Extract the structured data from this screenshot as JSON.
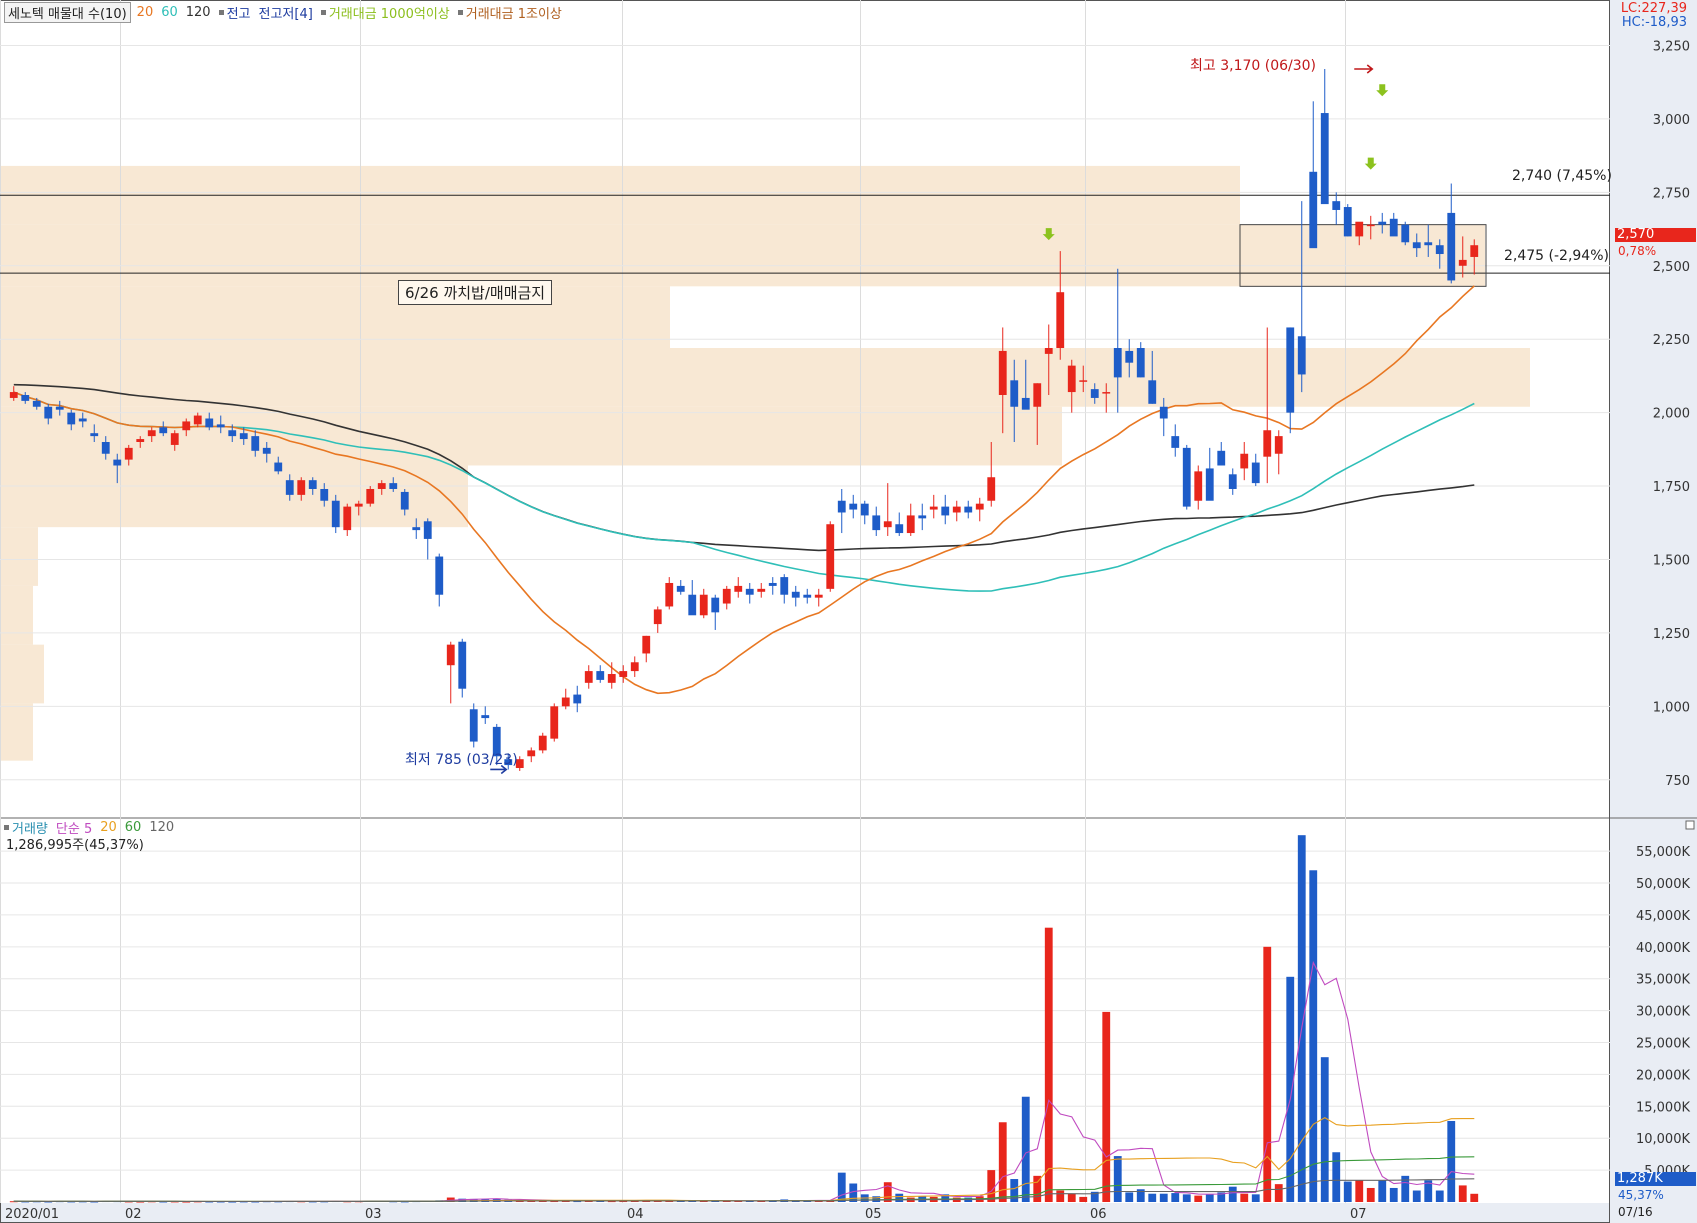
{
  "legend_top": {
    "title_box": "세노텍 매물대 수(10)",
    "ma20": "20",
    "ma60": "60",
    "ma120": "120",
    "item_high_low": "전고",
    "item_high_low2": "전고저[4]",
    "item_value1": "거래대금 1000억이상",
    "item_value2": "거래대금 1조이상"
  },
  "legend_volume": {
    "title": "거래량",
    "simple": "단순 5",
    "ma20": "20",
    "ma60": "60",
    "ma120": "120",
    "current": "1,286,995주(45,37%)"
  },
  "corner": {
    "lc": "LC:227,39",
    "hc": "HC:-18,93"
  },
  "annotations": {
    "high_label": "최고 3,170 (06/30)",
    "low_label": "최저 785 (03/23)",
    "note_box": "6/26 까치밥/매매금지",
    "line_upper": "2,740 (7,45%)",
    "line_lower": "2,475 (-2,94%)",
    "price_tag": "2,570",
    "price_pct": "0,78%",
    "vol_tag": "1,287K",
    "vol_pct": "45,37%",
    "date_end": "07/16"
  },
  "colors": {
    "up": "#e8261c",
    "down": "#1e5cc8",
    "ma5": "#e87722",
    "ma20": "#2fbfb8",
    "ma120": "#333333",
    "zone": "#f7e4cc",
    "vol_ma5": "#c04bc0",
    "vol_ma20": "#e8a020",
    "vol_ma60": "#3a9a3a",
    "vol_ma120": "#666666"
  },
  "chart_data": [
    {
      "type": "candlestick",
      "title": "",
      "y_ticks": [
        "3,250",
        "3,000",
        "2,750",
        "2,500",
        "2,250",
        "2,000",
        "1,750",
        "1,500",
        "1,250",
        "1,000",
        "750"
      ],
      "x_ticks": [
        "2020/01",
        "02",
        "03",
        "04",
        "05",
        "06",
        "07"
      ],
      "ylim": [
        630,
        3330
      ],
      "horizontal_lines": [
        2740,
        2475
      ],
      "series": [
        {
          "name": "price",
          "candles": [
            [
              2050,
              2090,
              2040,
              2070
            ],
            [
              2060,
              2070,
              2030,
              2040
            ],
            [
              2040,
              2050,
              2010,
              2020
            ],
            [
              2020,
              2030,
              1960,
              1980
            ],
            [
              2020,
              2040,
              1990,
              2010
            ],
            [
              2000,
              2010,
              1940,
              1960
            ],
            [
              1980,
              2000,
              1950,
              1970
            ],
            [
              1930,
              1960,
              1900,
              1920
            ],
            [
              1900,
              1920,
              1840,
              1860
            ],
            [
              1840,
              1860,
              1760,
              1820
            ],
            [
              1840,
              1890,
              1820,
              1880
            ],
            [
              1900,
              1920,
              1880,
              1910
            ],
            [
              1920,
              1950,
              1900,
              1940
            ],
            [
              1950,
              1970,
              1920,
              1930
            ],
            [
              1890,
              1940,
              1870,
              1930
            ],
            [
              1940,
              1980,
              1920,
              1970
            ],
            [
              1960,
              2000,
              1950,
              1990
            ],
            [
              1980,
              2000,
              1940,
              1950
            ],
            [
              1960,
              1990,
              1930,
              1950
            ],
            [
              1940,
              1960,
              1900,
              1920
            ],
            [
              1930,
              1950,
              1890,
              1910
            ],
            [
              1920,
              1940,
              1850,
              1870
            ],
            [
              1880,
              1900,
              1830,
              1860
            ],
            [
              1830,
              1850,
              1790,
              1800
            ],
            [
              1770,
              1790,
              1700,
              1720
            ],
            [
              1720,
              1780,
              1700,
              1770
            ],
            [
              1770,
              1780,
              1720,
              1740
            ],
            [
              1740,
              1760,
              1680,
              1700
            ],
            [
              1700,
              1720,
              1590,
              1610
            ],
            [
              1600,
              1690,
              1580,
              1680
            ],
            [
              1680,
              1700,
              1650,
              1690
            ],
            [
              1690,
              1750,
              1680,
              1740
            ],
            [
              1740,
              1770,
              1720,
              1760
            ],
            [
              1760,
              1780,
              1730,
              1740
            ],
            [
              1730,
              1740,
              1650,
              1670
            ],
            [
              1610,
              1640,
              1570,
              1600
            ],
            [
              1630,
              1640,
              1500,
              1570
            ],
            [
              1510,
              1520,
              1340,
              1380
            ],
            [
              1140,
              1220,
              1010,
              1210
            ],
            [
              1220,
              1230,
              1030,
              1060
            ],
            [
              990,
              1010,
              860,
              880
            ],
            [
              970,
              1000,
              940,
              960
            ],
            [
              930,
              940,
              800,
              830
            ],
            [
              820,
              840,
              785,
              800
            ],
            [
              790,
              830,
              780,
              820
            ],
            [
              830,
              860,
              810,
              850
            ],
            [
              850,
              910,
              840,
              900
            ],
            [
              890,
              1010,
              880,
              1000
            ],
            [
              1000,
              1060,
              990,
              1030
            ],
            [
              1040,
              1070,
              980,
              1010
            ],
            [
              1080,
              1140,
              1060,
              1120
            ],
            [
              1120,
              1140,
              1080,
              1090
            ],
            [
              1080,
              1150,
              1060,
              1110
            ],
            [
              1100,
              1140,
              1080,
              1120
            ],
            [
              1120,
              1170,
              1100,
              1150
            ],
            [
              1180,
              1240,
              1150,
              1240
            ],
            [
              1280,
              1340,
              1250,
              1330
            ],
            [
              1340,
              1440,
              1330,
              1420
            ],
            [
              1410,
              1430,
              1380,
              1390
            ],
            [
              1380,
              1430,
              1320,
              1310
            ],
            [
              1310,
              1400,
              1300,
              1380
            ],
            [
              1370,
              1380,
              1260,
              1320
            ],
            [
              1350,
              1410,
              1330,
              1400
            ],
            [
              1390,
              1440,
              1370,
              1410
            ],
            [
              1400,
              1420,
              1350,
              1380
            ],
            [
              1390,
              1420,
              1370,
              1400
            ],
            [
              1420,
              1440,
              1380,
              1410
            ],
            [
              1440,
              1450,
              1350,
              1380
            ],
            [
              1390,
              1410,
              1340,
              1370
            ],
            [
              1380,
              1400,
              1350,
              1370
            ],
            [
              1370,
              1400,
              1340,
              1380
            ],
            [
              1400,
              1630,
              1390,
              1620
            ],
            [
              1700,
              1740,
              1590,
              1660
            ],
            [
              1690,
              1720,
              1640,
              1670
            ],
            [
              1690,
              1700,
              1620,
              1650
            ],
            [
              1650,
              1680,
              1580,
              1600
            ],
            [
              1610,
              1760,
              1580,
              1630
            ],
            [
              1620,
              1660,
              1580,
              1590
            ],
            [
              1590,
              1690,
              1580,
              1650
            ],
            [
              1650,
              1690,
              1600,
              1640
            ],
            [
              1670,
              1720,
              1640,
              1680
            ],
            [
              1680,
              1720,
              1620,
              1650
            ],
            [
              1660,
              1700,
              1630,
              1680
            ],
            [
              1680,
              1700,
              1640,
              1660
            ],
            [
              1670,
              1710,
              1630,
              1690
            ],
            [
              1700,
              1900,
              1680,
              1780
            ],
            [
              2060,
              2290,
              1930,
              2210
            ],
            [
              2110,
              2180,
              1900,
              2020
            ],
            [
              2050,
              2180,
              2020,
              2010
            ],
            [
              2020,
              2100,
              1890,
              2100
            ],
            [
              2200,
              2300,
              2060,
              2220
            ],
            [
              2220,
              2550,
              2180,
              2410
            ],
            [
              2070,
              2180,
              2000,
              2160
            ],
            [
              2110,
              2160,
              2070,
              2110
            ],
            [
              2080,
              2100,
              2030,
              2050
            ],
            [
              2070,
              2100,
              2000,
              2070
            ],
            [
              2220,
              2490,
              2000,
              2120
            ],
            [
              2210,
              2250,
              2120,
              2170
            ],
            [
              2220,
              2240,
              2120,
              2120
            ],
            [
              2110,
              2210,
              2030,
              2030
            ],
            [
              2020,
              2050,
              1920,
              1980
            ],
            [
              1920,
              1960,
              1850,
              1880
            ],
            [
              1880,
              1890,
              1670,
              1680
            ],
            [
              1700,
              1820,
              1670,
              1800
            ],
            [
              1810,
              1880,
              1730,
              1700
            ],
            [
              1870,
              1900,
              1820,
              1820
            ],
            [
              1790,
              1810,
              1720,
              1740
            ],
            [
              1810,
              1900,
              1770,
              1860
            ],
            [
              1830,
              1860,
              1750,
              1760
            ],
            [
              1850,
              2290,
              1760,
              1940
            ],
            [
              1860,
              1940,
              1790,
              1920
            ],
            [
              2290,
              2290,
              1930,
              2000
            ],
            [
              2260,
              2720,
              2070,
              2130
            ],
            [
              2820,
              3060,
              2650,
              2560
            ],
            [
              3020,
              3170,
              2790,
              2710
            ],
            [
              2720,
              2750,
              2640,
              2690
            ],
            [
              2700,
              2710,
              2600,
              2600
            ],
            [
              2600,
              2640,
              2570,
              2650
            ],
            [
              2640,
              2670,
              2590,
              2640
            ],
            [
              2650,
              2680,
              2610,
              2640
            ],
            [
              2660,
              2680,
              2610,
              2600
            ],
            [
              2640,
              2650,
              2570,
              2580
            ],
            [
              2580,
              2610,
              2530,
              2560
            ],
            [
              2580,
              2640,
              2530,
              2570
            ],
            [
              2570,
              2590,
              2490,
              2540
            ],
            [
              2680,
              2780,
              2440,
              2450
            ],
            [
              2500,
              2600,
              2460,
              2520
            ],
            [
              2530,
              2590,
              2470,
              2570
            ]
          ]
        },
        {
          "name": "20",
          "note": "moving average (orange)"
        },
        {
          "name": "60",
          "note": "moving average (teal)"
        },
        {
          "name": "120",
          "note": "moving average (black)"
        }
      ]
    },
    {
      "type": "bar",
      "title": "거래량",
      "y_ticks": [
        "55,000K",
        "50,000K",
        "45,000K",
        "40,000K",
        "35,000K",
        "30,000K",
        "25,000K",
        "20,000K",
        "15,000K",
        "10,000K",
        "5,000K"
      ],
      "ylim": [
        0,
        58000
      ],
      "values_k": [
        120,
        90,
        110,
        80,
        130,
        90,
        100,
        80,
        150,
        140,
        90,
        70,
        110,
        80,
        90,
        70,
        100,
        80,
        80,
        70,
        90,
        80,
        120,
        100,
        140,
        110,
        90,
        100,
        150,
        110,
        120,
        180,
        160,
        110,
        90,
        140,
        170,
        260,
        700,
        520,
        480,
        400,
        480,
        350,
        300,
        200,
        160,
        150,
        160,
        140,
        170,
        160,
        140,
        150,
        170,
        230,
        260,
        280,
        220,
        180,
        230,
        160,
        170,
        200,
        190,
        160,
        200,
        400,
        260,
        180,
        240,
        220,
        4600,
        2900,
        1200,
        900,
        3100,
        1300,
        700,
        900,
        800,
        1200,
        700,
        700,
        900,
        5000,
        12500,
        3600,
        16500,
        4100,
        43000,
        1800,
        1300,
        800,
        1600,
        29800,
        7200,
        1500,
        2000,
        1300,
        1300,
        1400,
        1200,
        1000,
        1200,
        1500,
        2400,
        1300,
        1200,
        40000,
        2800,
        35300,
        57500,
        52000,
        22700,
        7800,
        3200,
        3400,
        2200,
        3400,
        2200,
        4100,
        1800,
        3400,
        1800,
        12700,
        2600,
        1287
      ]
    }
  ]
}
